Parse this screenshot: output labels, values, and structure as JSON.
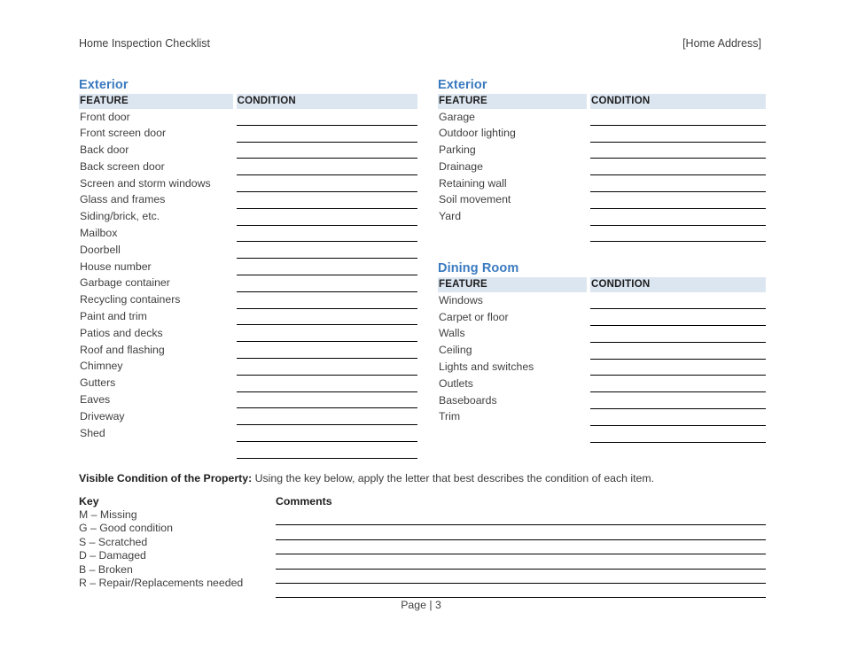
{
  "header": {
    "title": "Home Inspection Checklist",
    "address": "[Home Address]"
  },
  "column_headers": {
    "feature": "FEATURE",
    "condition": "CONDITION"
  },
  "sections": [
    {
      "title": "Exterior",
      "column": "left",
      "features": [
        "Front door",
        "Front screen door",
        "Back door",
        "Back screen door",
        "Screen and storm windows",
        "Glass and frames",
        "Siding/brick, etc.",
        "Mailbox",
        "Doorbell",
        "House number",
        "Garbage container",
        "Recycling containers",
        "Paint and trim",
        "Patios and decks",
        "Roof and flashing",
        "Chimney",
        "Gutters",
        "Eaves",
        "Driveway",
        "Shed"
      ],
      "blank_rows": 1
    },
    {
      "title": "Exterior",
      "column": "right",
      "features": [
        "Garage",
        "Outdoor lighting",
        "Parking",
        "Drainage",
        "Retaining wall",
        "Soil movement",
        "Yard"
      ],
      "blank_rows": 1
    },
    {
      "title": "Dining Room",
      "column": "right",
      "features": [
        "Windows",
        "Carpet or floor",
        "Walls",
        "Ceiling",
        "Lights and switches",
        "Outlets",
        "Baseboards",
        "Trim"
      ],
      "blank_rows": 1
    }
  ],
  "visible_condition": {
    "lead": "Visible Condition of the Property:",
    "text": " Using the key below, apply the letter that best describes the condition of each item."
  },
  "key": {
    "heading": "Key",
    "items": [
      "M – Missing",
      "G – Good condition",
      "S – Scratched",
      "D – Damaged",
      "B – Broken",
      "R – Repair/Replacements needed"
    ]
  },
  "comments": {
    "heading": "Comments",
    "line_count": 6
  },
  "footer": {
    "page_label": "Page  |  3"
  },
  "colors": {
    "section_title": "#3a7ac0",
    "table_header_bg": "#dce6f1",
    "rule": "#000000",
    "body_text": "#3f3f3f"
  }
}
